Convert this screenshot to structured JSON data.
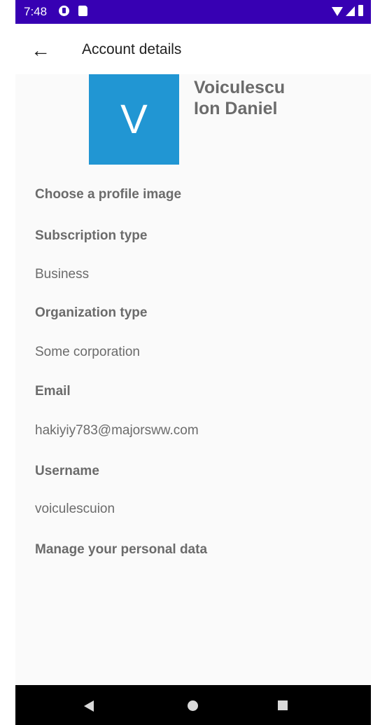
{
  "status_bar": {
    "time": "7:48",
    "background_color": "#3700b3",
    "icons": [
      "notification-icon",
      "sd-card-icon",
      "wifi-icon",
      "signal-icon",
      "battery-icon"
    ]
  },
  "app_bar": {
    "back_icon": "arrow-left-icon",
    "back_glyph": "←",
    "title": "Account details"
  },
  "profile": {
    "avatar_letter": "V",
    "avatar_color": "#2196d3",
    "name_line1": "Voiculescu",
    "name_line2": "Ion Daniel"
  },
  "items": {
    "choose_profile_image": "Choose a profile image",
    "subscription_type_label": "Subscription type",
    "subscription_type_value": "Business",
    "organization_type_label": "Organization type",
    "organization_type_value": "Some corporation",
    "email_label": "Email",
    "email_value": "hakiyiy783@majorsww.com",
    "username_label": "Username",
    "username_value": "voiculescuion",
    "manage_personal_data": "Manage your personal data"
  },
  "nav_bar": {
    "icons": [
      "nav-back-icon",
      "nav-home-icon",
      "nav-recents-icon"
    ]
  }
}
